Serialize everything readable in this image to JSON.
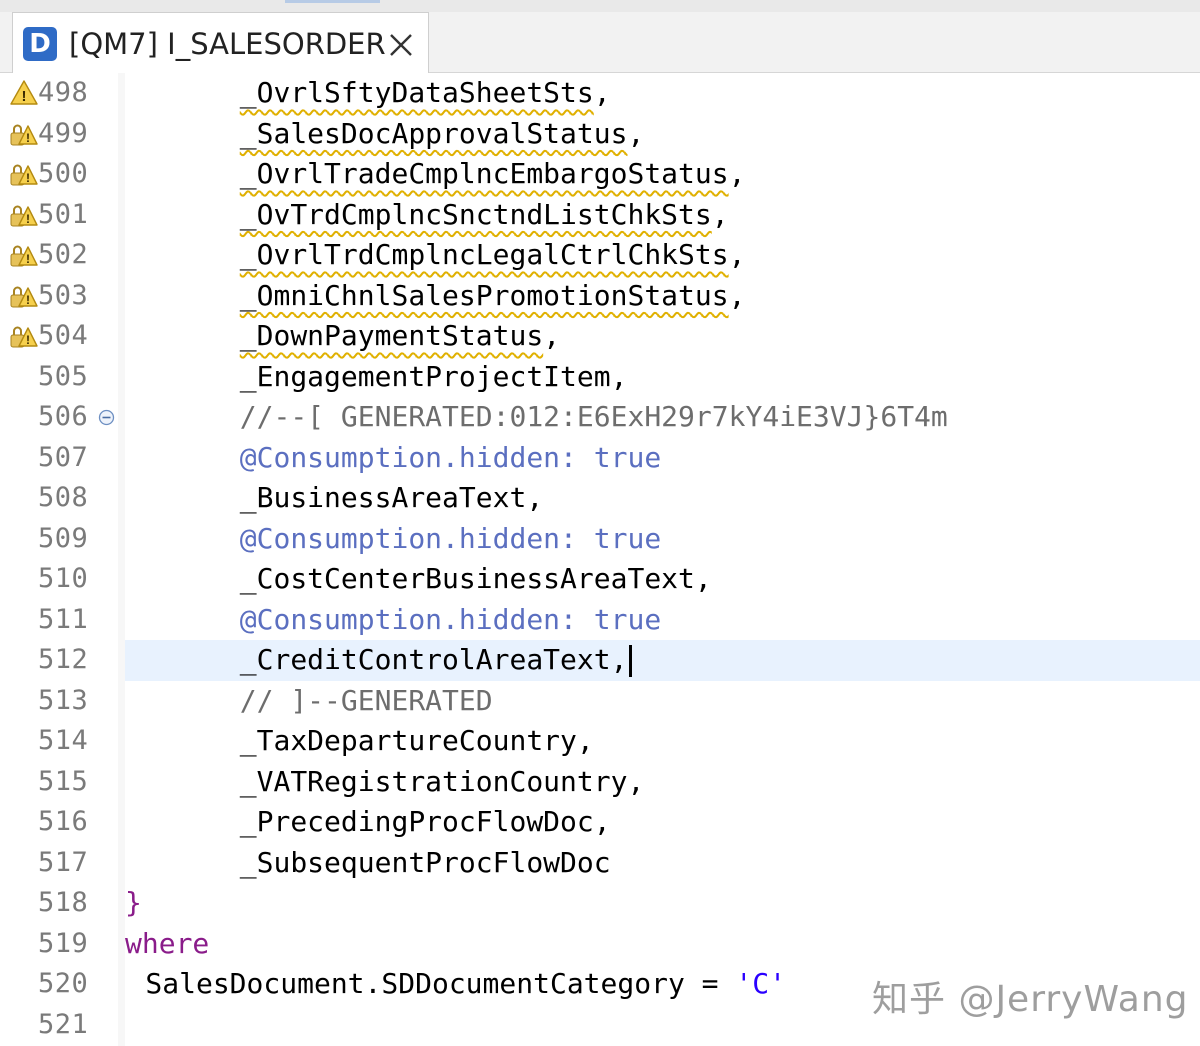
{
  "tab": {
    "icon_letter": "D",
    "title": "[QM7] I_SALESORDER"
  },
  "lines": [
    {
      "num": "498",
      "marker": "warning",
      "fold": "",
      "indent": 9,
      "parts": [
        {
          "t": "_OvrlSftyDataSheetSts",
          "c": "assoc",
          "u": true
        },
        {
          "t": ",",
          "c": "assoc"
        }
      ]
    },
    {
      "num": "499",
      "marker": "warning-lock",
      "fold": "",
      "indent": 9,
      "parts": [
        {
          "t": "_SalesDocApprovalStatus",
          "c": "assoc",
          "u": true
        },
        {
          "t": ",",
          "c": "assoc"
        }
      ]
    },
    {
      "num": "500",
      "marker": "warning-lock",
      "fold": "",
      "indent": 9,
      "parts": [
        {
          "t": "_OvrlTradeCmplncEmbargoStatus",
          "c": "assoc",
          "u": true
        },
        {
          "t": ",",
          "c": "assoc"
        }
      ]
    },
    {
      "num": "501",
      "marker": "warning-lock",
      "fold": "",
      "indent": 9,
      "parts": [
        {
          "t": "_OvTrdCmplncSnctndListChkSts",
          "c": "assoc",
          "u": true
        },
        {
          "t": ",",
          "c": "assoc"
        }
      ]
    },
    {
      "num": "502",
      "marker": "warning-lock",
      "fold": "",
      "indent": 9,
      "parts": [
        {
          "t": "_OvrlTrdCmplncLegalCtrlChkSts",
          "c": "assoc",
          "u": true
        },
        {
          "t": ",",
          "c": "assoc"
        }
      ]
    },
    {
      "num": "503",
      "marker": "warning-lock",
      "fold": "",
      "indent": 9,
      "parts": [
        {
          "t": "_OmniChnlSalesPromotionStatus",
          "c": "assoc",
          "u": true
        },
        {
          "t": ",",
          "c": "assoc"
        }
      ]
    },
    {
      "num": "504",
      "marker": "warning-lock",
      "fold": "",
      "indent": 9,
      "parts": [
        {
          "t": "_DownPaymentStatus",
          "c": "assoc",
          "u": true
        },
        {
          "t": ",",
          "c": "assoc"
        }
      ]
    },
    {
      "num": "505",
      "marker": "",
      "fold": "",
      "indent": 9,
      "parts": [
        {
          "t": "_EngagementProjectItem,",
          "c": "assoc"
        }
      ]
    },
    {
      "num": "506",
      "marker": "",
      "fold": "collapse",
      "indent": 9,
      "parts": [
        {
          "t": "//--[ GENERATED:012:E6ExH29r7kY4iE3VJ}6T4m",
          "c": "comment"
        }
      ]
    },
    {
      "num": "507",
      "marker": "",
      "fold": "",
      "indent": 9,
      "parts": [
        {
          "t": "@Consumption.hidden: ",
          "c": "annot"
        },
        {
          "t": "true",
          "c": "bool"
        }
      ]
    },
    {
      "num": "508",
      "marker": "",
      "fold": "",
      "indent": 9,
      "parts": [
        {
          "t": "_BusinessAreaText,",
          "c": "assoc"
        }
      ]
    },
    {
      "num": "509",
      "marker": "",
      "fold": "",
      "indent": 9,
      "parts": [
        {
          "t": "@Consumption.hidden: ",
          "c": "annot"
        },
        {
          "t": "true",
          "c": "bool"
        }
      ]
    },
    {
      "num": "510",
      "marker": "",
      "fold": "",
      "indent": 9,
      "parts": [
        {
          "t": "_CostCenterBusinessAreaText,",
          "c": "assoc"
        }
      ]
    },
    {
      "num": "511",
      "marker": "",
      "fold": "",
      "indent": 9,
      "parts": [
        {
          "t": "@Consumption.hidden: ",
          "c": "annot"
        },
        {
          "t": "true",
          "c": "bool"
        }
      ]
    },
    {
      "num": "512",
      "marker": "",
      "fold": "",
      "indent": 9,
      "current": true,
      "caret": true,
      "parts": [
        {
          "t": "_CreditControlAreaText,",
          "c": "assoc"
        }
      ]
    },
    {
      "num": "513",
      "marker": "",
      "fold": "",
      "indent": 9,
      "parts": [
        {
          "t": "// ]--GENERATED",
          "c": "comment"
        }
      ]
    },
    {
      "num": "514",
      "marker": "",
      "fold": "",
      "indent": 9,
      "parts": [
        {
          "t": "_TaxDepartureCountry,",
          "c": "assoc"
        }
      ]
    },
    {
      "num": "515",
      "marker": "",
      "fold": "",
      "indent": 9,
      "parts": [
        {
          "t": "_VATRegistrationCountry,",
          "c": "assoc"
        }
      ]
    },
    {
      "num": "516",
      "marker": "",
      "fold": "",
      "indent": 9,
      "parts": [
        {
          "t": "_PrecedingProcFlowDoc,",
          "c": "assoc"
        }
      ]
    },
    {
      "num": "517",
      "marker": "",
      "fold": "",
      "indent": 9,
      "parts": [
        {
          "t": "_SubsequentProcFlowDoc",
          "c": "assoc"
        }
      ]
    },
    {
      "num": "518",
      "marker": "",
      "fold": "",
      "indent": 0,
      "parts": [
        {
          "t": "}",
          "c": "kw"
        }
      ]
    },
    {
      "num": "519",
      "marker": "",
      "fold": "",
      "indent": 0,
      "parts": [
        {
          "t": "where",
          "c": "kw"
        }
      ]
    },
    {
      "num": "520",
      "marker": "",
      "fold": "",
      "indent": 1.6,
      "parts": [
        {
          "t": "SalesDocument.SDDocumentCategory = ",
          "c": "assoc"
        },
        {
          "t": "'C'",
          "c": "str"
        }
      ]
    },
    {
      "num": "521",
      "marker": "",
      "fold": "",
      "indent": 0,
      "parts": []
    }
  ],
  "watermark": "知乎 @JerryWang"
}
